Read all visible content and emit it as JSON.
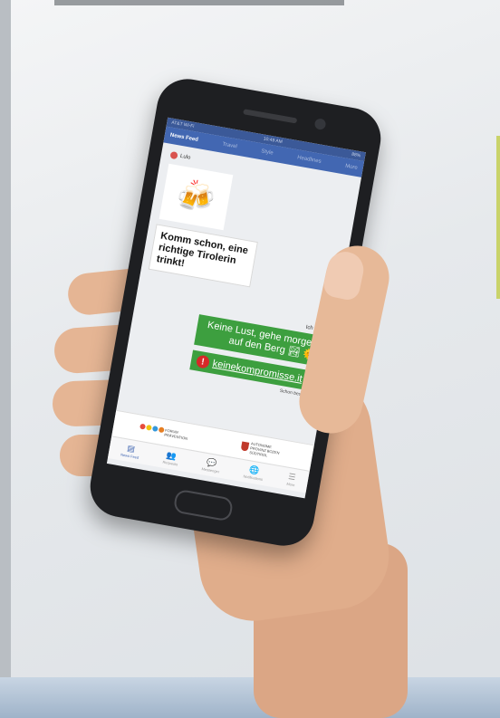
{
  "status": {
    "carrier": "AT&T Wi-Fi",
    "time": "10:49 AM",
    "battery": "88%"
  },
  "nav": {
    "tabs": [
      "News Feed",
      "Travel",
      "Style",
      "Headlines",
      "More"
    ]
  },
  "chat": {
    "sender": "Lulo",
    "incoming": "Komm schon, eine richtige Tirolerin trinkt!",
    "me": "Ich",
    "me_emoji": "😎",
    "outgoing": "Keine Lust, gehe morgen auf den Berg 🏞 🌞",
    "link": "keinekompromisse.it",
    "alert": "!",
    "seen": "Schon besucht?"
  },
  "footer": {
    "logo1": "FORUM PRÄVENTION",
    "logo2": "AUTONOME PROVINZ BOZEN SÜDTIROL"
  },
  "tabbar": [
    {
      "label": "News Feed",
      "icon": "▤"
    },
    {
      "label": "Requests",
      "icon": "👥"
    },
    {
      "label": "Messenger",
      "icon": "💬"
    },
    {
      "label": "Notifications",
      "icon": "🌐"
    },
    {
      "label": "More",
      "icon": "☰"
    }
  ],
  "colors": {
    "facebook_blue": "#4267b2",
    "message_green": "#3d9f3f",
    "alert_red": "#d62828"
  }
}
